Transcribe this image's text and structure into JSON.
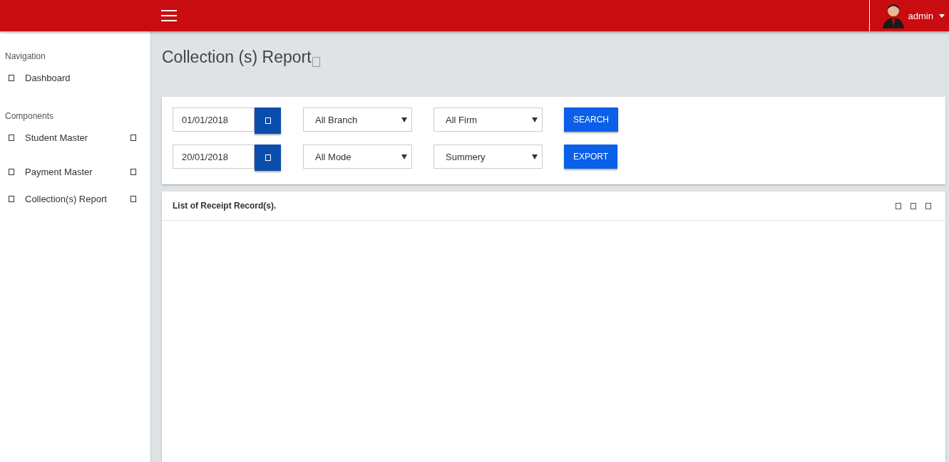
{
  "topbar": {
    "user": "admin"
  },
  "sidebar": {
    "sections": [
      {
        "heading": "Navigation",
        "items": [
          {
            "label": "Dashboard",
            "has_submenu": false
          }
        ]
      },
      {
        "heading": "Components",
        "items": [
          {
            "label": "Student Master",
            "has_submenu": true
          },
          {
            "label": "Payment Master",
            "has_submenu": true
          },
          {
            "label": "Collection(s) Report",
            "has_submenu": true
          }
        ]
      }
    ]
  },
  "page": {
    "title": "Collection (s) Report"
  },
  "filters": {
    "rows": [
      {
        "date": "01/01/2018",
        "selects": [
          "All Branch",
          "All Firm"
        ],
        "button": "SEARCH"
      },
      {
        "date": "20/01/2018",
        "selects": [
          "All Mode",
          "Summery"
        ],
        "button": "EXPORT"
      }
    ]
  },
  "panel": {
    "title": "List of Receipt Record(s)."
  }
}
